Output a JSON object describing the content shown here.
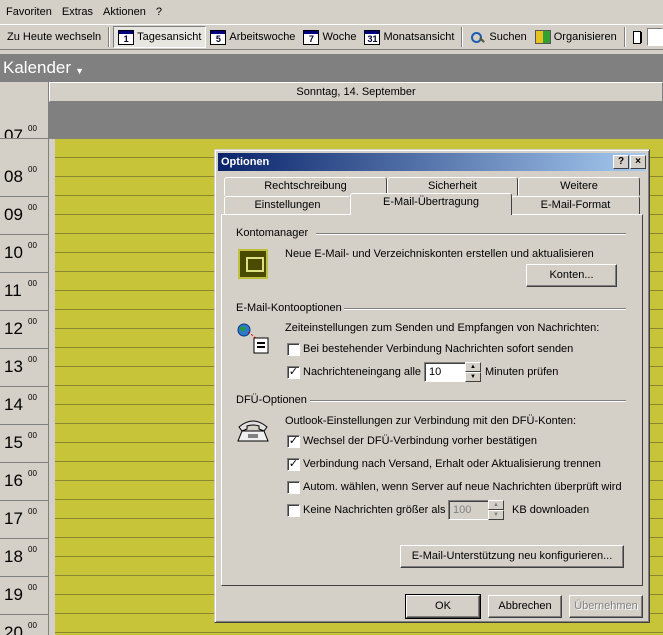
{
  "menu": [
    "Favoriten",
    "Extras",
    "Aktionen",
    "?"
  ],
  "toolbar": {
    "today": "Zu Heute wechseln",
    "day_view": "Tagesansicht",
    "day_num": "1",
    "workweek": "Arbeitswoche",
    "workweek_num": "5",
    "week": "Woche",
    "week_num": "7",
    "month": "Monatsansicht",
    "month_num": "31",
    "search": "Suchen",
    "organize": "Organisieren"
  },
  "calendar": {
    "title": "Kalender",
    "day_header": "Sonntag, 14. September",
    "hours": [
      "07",
      "08",
      "09",
      "10",
      "11",
      "12",
      "13",
      "14",
      "15",
      "16",
      "17",
      "18",
      "19",
      "20"
    ],
    "minutes": "00"
  },
  "dialog": {
    "title": "Optionen",
    "help_btn": "?",
    "close_btn": "×",
    "tabs_back": [
      "Rechtschreibung",
      "Sicherheit",
      "Weitere"
    ],
    "tabs_front": [
      "Einstellungen",
      "E-Mail-Übertragung",
      "E-Mail-Format"
    ],
    "active_tab": "E-Mail-Übertragung",
    "kontomanager": {
      "heading": "Kontomanager",
      "text": "Neue E-Mail- und Verzeichniskonten erstellen und aktualisieren",
      "button": "Konten..."
    },
    "kontooptionen": {
      "heading": "E-Mail-Kontooptionen",
      "text": "Zeiteinstellungen zum Senden und Empfangen von Nachrichten:",
      "cb1": "Bei bestehender Verbindung Nachrichten sofort senden",
      "cb1_checked": false,
      "cb2_pre": "Nachrichteneingang alle",
      "cb2_value": "10",
      "cb2_post": "Minuten prüfen",
      "cb2_checked": true
    },
    "dfu": {
      "heading": "DFÜ-Optionen",
      "text": "Outlook-Einstellungen zur Verbindung mit den DFÜ-Konten:",
      "cb1": "Wechsel der DFÜ-Verbindung vorher bestätigen",
      "cb1_checked": true,
      "cb2": "Verbindung nach Versand, Erhalt oder Aktualisierung trennen",
      "cb2_checked": true,
      "cb3": "Autom. wählen, wenn Server auf neue Nachrichten überprüft wird",
      "cb3_checked": false,
      "cb4_pre": "Keine Nachrichten größer als",
      "cb4_value": "100",
      "cb4_post": "KB downloaden",
      "cb4_checked": false,
      "reconfigure": "E-Mail-Unterstützung neu konfigurieren..."
    },
    "buttons": {
      "ok": "OK",
      "cancel": "Abbrechen",
      "apply": "Übernehmen"
    }
  },
  "colors": {
    "slot_yellow": "#c8c43a",
    "title_blue": "#0a246a"
  }
}
